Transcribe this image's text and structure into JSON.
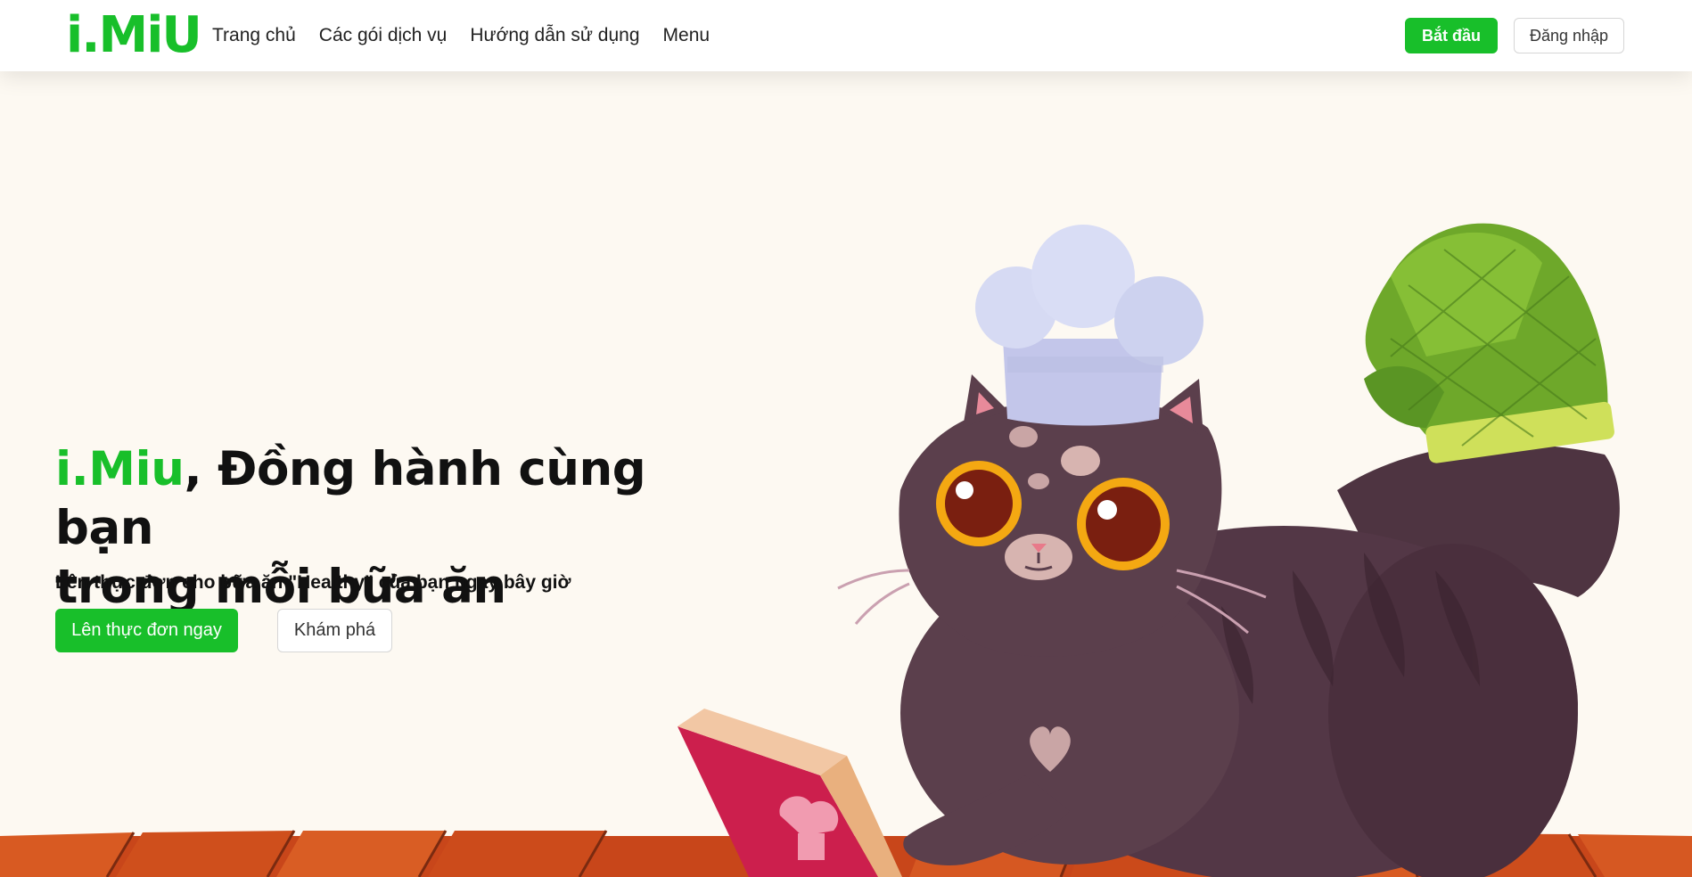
{
  "brand": {
    "logo_text": "i.MiU",
    "name": "i.Miu"
  },
  "nav": {
    "links": [
      "Trang chủ",
      "Các gói dịch vụ",
      "Hướng dẫn sử dụng",
      "Menu"
    ],
    "start_label": "Bắt đầu",
    "login_label": "Đăng nhập"
  },
  "hero": {
    "title_rest_line1": ", Đồng hành cùng bạn",
    "title_line2": "trong mỗi bữa ăn",
    "subtitle": "Lên thực đơn cho bữa ăn \"Healthy\" của bạn ngay bây giờ",
    "primary_button": "Lên thực đơn ngay",
    "secondary_button": "Khám phá"
  },
  "colors": {
    "accent": "#18bf2a",
    "background": "#fdf9f2",
    "floor": "#d2521a",
    "cat_body": "#5b3f4c"
  },
  "illustration": {
    "icons": [
      "chef-hat",
      "oven-mitt",
      "cookbook",
      "cat"
    ]
  }
}
